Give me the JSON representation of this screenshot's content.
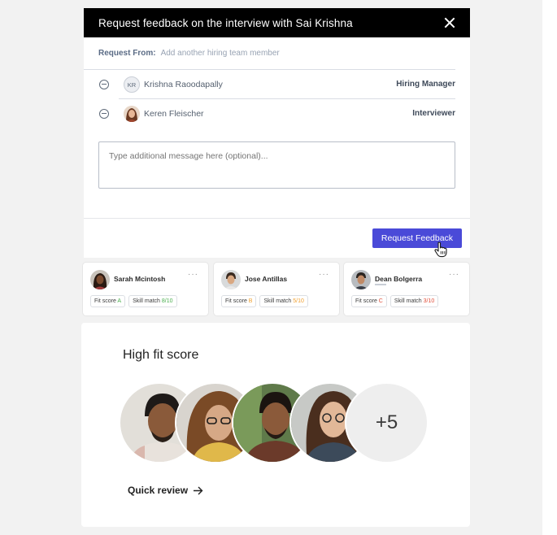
{
  "modal": {
    "title": "Request feedback on the interview with Sai Krishna",
    "request_from_label": "Request From:",
    "request_from_placeholder": "Add another hiring team member",
    "members": [
      {
        "initials": "KR",
        "name": "Krishna Raoodapally",
        "role": "Hiring Manager"
      },
      {
        "initials": "",
        "name": "Keren Fleischer",
        "role": "Interviewer"
      }
    ],
    "message_placeholder": "Type additional message here (optional)...",
    "submit_label": "Request Feedback"
  },
  "cards": [
    {
      "name": "Sarah Mcintosh",
      "fit_label": "Fit score",
      "fit_value": "A",
      "skill_label": "Skill match",
      "skill_value": "8/10",
      "fit_color": "#4caf50",
      "skill_color": "#4caf50"
    },
    {
      "name": "Jose Antillas",
      "fit_label": "Fit score",
      "fit_value": "B",
      "skill_label": "Skill match",
      "skill_value": "5/10",
      "fit_color": "#f0a030",
      "skill_color": "#f0a030"
    },
    {
      "name": "Dean Bolgerra",
      "fit_label": "Fit score",
      "fit_value": "C",
      "skill_label": "Skill match",
      "skill_value": "3/10",
      "fit_color": "#e0503c",
      "skill_color": "#e0503c"
    }
  ],
  "fit_section": {
    "title": "High fit score",
    "more_count": "+5",
    "quick_review": "Quick review"
  },
  "icons": {
    "close": "close-icon",
    "remove": "minus-circle-icon",
    "more": "more-dots-icon",
    "arrow": "arrow-right-icon",
    "cursor": "hand-pointer-icon"
  },
  "colors": {
    "header_bg": "#000000",
    "primary_button": "#4a4ad8"
  }
}
